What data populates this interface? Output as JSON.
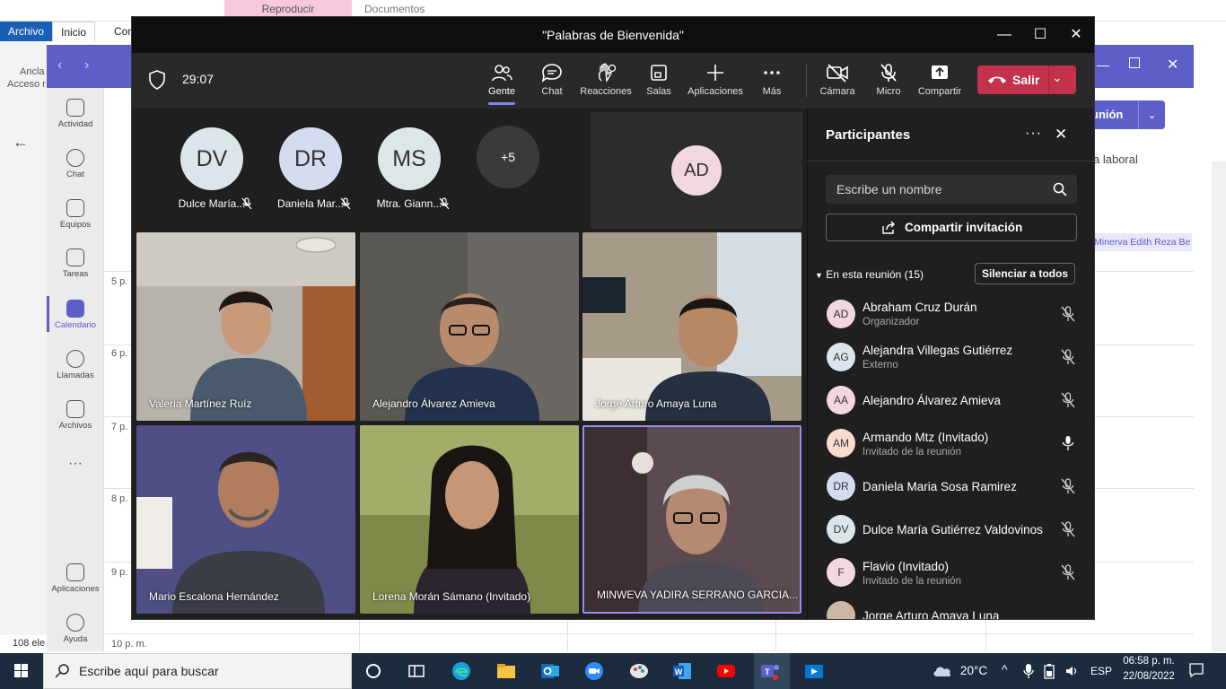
{
  "explorer": {
    "archivo_tab": "Archivo",
    "inicio_tab": "Inicio",
    "com_tab": "Com",
    "reproducir_tab": "Reproducir",
    "documentos_label": "Documentos",
    "anclar_label": "Ancla",
    "acceso_label": "Acceso r",
    "items_count": "108 ele"
  },
  "teams_rail": {
    "items": [
      {
        "label": "Actividad"
      },
      {
        "label": "Chat"
      },
      {
        "label": "Equipos"
      },
      {
        "label": "Tareas"
      },
      {
        "label": "Calendario"
      },
      {
        "label": "Llamadas"
      },
      {
        "label": "Archivos"
      },
      {
        "label": "Aplicaciones"
      },
      {
        "label": "Ayuda"
      }
    ]
  },
  "calendar": {
    "hours": [
      "5 p.",
      "6 p.",
      "7 p.",
      "8 p.",
      "9 p.",
      "10 p. m."
    ],
    "join_label": "unión",
    "laboral_label": "a laboral",
    "event_chip": "Minerva Edith Reza Be"
  },
  "meeting": {
    "title": "\"Palabras de Bienvenida\"",
    "timer": "29:07",
    "toolbar": {
      "gente": "Gente",
      "chat": "Chat",
      "reacciones": "Reacciones",
      "salas": "Salas",
      "aplicaciones": "Aplicaciones",
      "mas": "Más",
      "camara": "Cámara",
      "micro": "Micro",
      "compartir": "Compartir",
      "salir": "Salir"
    },
    "top_strip": [
      {
        "initials": "DV",
        "name": "Dulce María...",
        "color": "#dce6ea"
      },
      {
        "initials": "DR",
        "name": "Daniela Mar...",
        "color": "#d5dcef"
      },
      {
        "initials": "MS",
        "name": "Mtra. Giann...",
        "color": "#dde6e8"
      }
    ],
    "overflow_count": "+5",
    "ad_tile_initials": "AD",
    "video_tiles": [
      {
        "name": "Valeria Martínez Ruíz"
      },
      {
        "name": "Alejandro Álvarez Amieva"
      },
      {
        "name": "Jorge Arturo Amaya Luna"
      },
      {
        "name": "Mario Escalona Hernández"
      },
      {
        "name": "Lorena Morán Sámano (Invitado)"
      },
      {
        "name": "MINWEVA YADIRA SERRANO GARCIA..."
      }
    ]
  },
  "participants": {
    "title": "Participantes",
    "search_placeholder": "Escribe un nombre",
    "invite_label": "Compartir invitación",
    "section_label": "En esta reunión (15)",
    "mute_all_label": "Silenciar a todos",
    "list": [
      {
        "initials": "AD",
        "name": "Abraham Cruz Durán",
        "role": "Organizador",
        "color": "#f2d7de"
      },
      {
        "initials": "AG",
        "name": "Alejandra Villegas Gutiérrez",
        "role": "Externo",
        "color": "#dce6ea"
      },
      {
        "initials": "AA",
        "name": "Alejandro Álvarez Amieva",
        "role": "",
        "color": "#f2d7de"
      },
      {
        "initials": "AM",
        "name": "Armando Mtz (Invitado)",
        "role": "Invitado de la reunión",
        "color": "#f9dcd0"
      },
      {
        "initials": "DR",
        "name": "Daniela Maria Sosa Ramirez",
        "role": "",
        "color": "#d5dcef"
      },
      {
        "initials": "DV",
        "name": "Dulce María Gutiérrez Valdovinos",
        "role": "",
        "color": "#dce6ea"
      },
      {
        "initials": "F",
        "name": "Flavio (Invitado)",
        "role": "Invitado de la reunión",
        "color": "#f2d7de"
      },
      {
        "initials": "",
        "name": "Jorge Arturo Amaya Luna",
        "role": "",
        "color": "#c9b7a5"
      }
    ]
  },
  "taskbar": {
    "search_placeholder": "Escribe aquí para buscar",
    "temperature": "20°C",
    "language": "ESP",
    "time": "06:58 p. m.",
    "date": "22/08/2022"
  }
}
